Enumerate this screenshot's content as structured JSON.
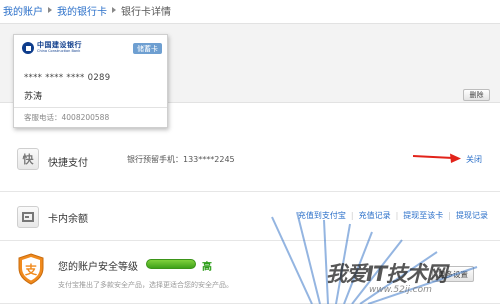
{
  "breadcrumb": {
    "items": [
      "我的账户",
      "我的银行卡"
    ],
    "current": "银行卡详情"
  },
  "card": {
    "bank_name_cn": "中国建设银行",
    "bank_name_en": "China Construction Bank",
    "type": "储蓄卡",
    "number": "**** **** **** 0289",
    "holder": "苏涛",
    "service_phone": "客服电话：4008200588"
  },
  "toolbar": {
    "delete_label": "删除"
  },
  "quick_pay": {
    "icon_char": "快",
    "title": "快捷支付",
    "phone": "银行预留手机：133****2245",
    "close_label": "关闭"
  },
  "balance": {
    "title": "卡内余额",
    "links": [
      "充值到支付宝",
      "充值记录",
      "提现至该卡",
      "提现记录"
    ]
  },
  "security": {
    "icon_char": "支",
    "title": "您的账户安全等级",
    "level": "高",
    "description": "支付宝推出了多款安全产品，选择更适合您的安全产品。",
    "button_label": "更多设置"
  },
  "watermark": {
    "text_main": "我爱IT技术网",
    "url": "www.52ij.com"
  },
  "colors": {
    "link": "#2a6fc9",
    "arrow": "#e2231a",
    "security_green": "#3fa11a",
    "shield_orange": "#f08a1d",
    "bank_blue": "#0e3d8c"
  }
}
